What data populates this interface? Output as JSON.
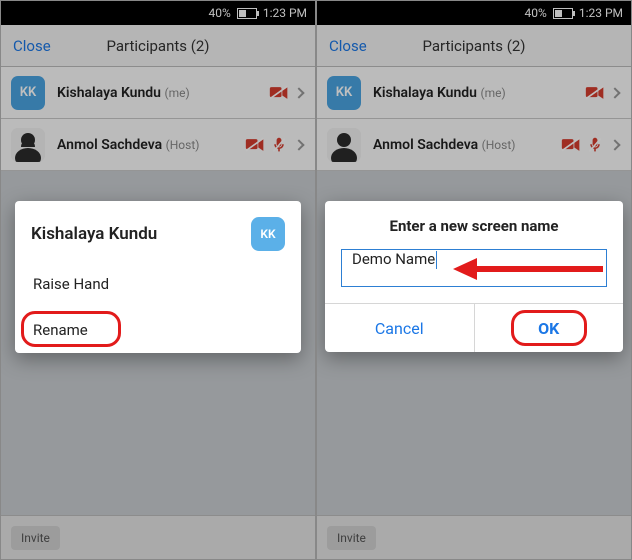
{
  "status": {
    "battery": "40%",
    "time": "1:23 PM"
  },
  "nav": {
    "close": "Close",
    "title": "Participants (2)"
  },
  "participants": [
    {
      "initials": "KK",
      "name": "Kishalaya Kundu",
      "tag": "(me)",
      "avatarKind": "initials",
      "cam_off": true,
      "mic_off": false
    },
    {
      "initials": "",
      "name": "Anmol Sachdeva",
      "tag": "(Host)",
      "avatarKind": "photo",
      "cam_off": true,
      "mic_off": true
    }
  ],
  "invite": "Invite",
  "actionSheet": {
    "title": "Kishalaya Kundu",
    "initials": "KK",
    "items": [
      "Raise Hand",
      "Rename"
    ]
  },
  "renameDialog": {
    "title": "Enter a new screen name",
    "value": "Demo Name",
    "cancel": "Cancel",
    "ok": "OK"
  },
  "colors": {
    "accent": "#1b77e6",
    "danger": "#d43c2e",
    "highlight": "#e21b1b"
  }
}
